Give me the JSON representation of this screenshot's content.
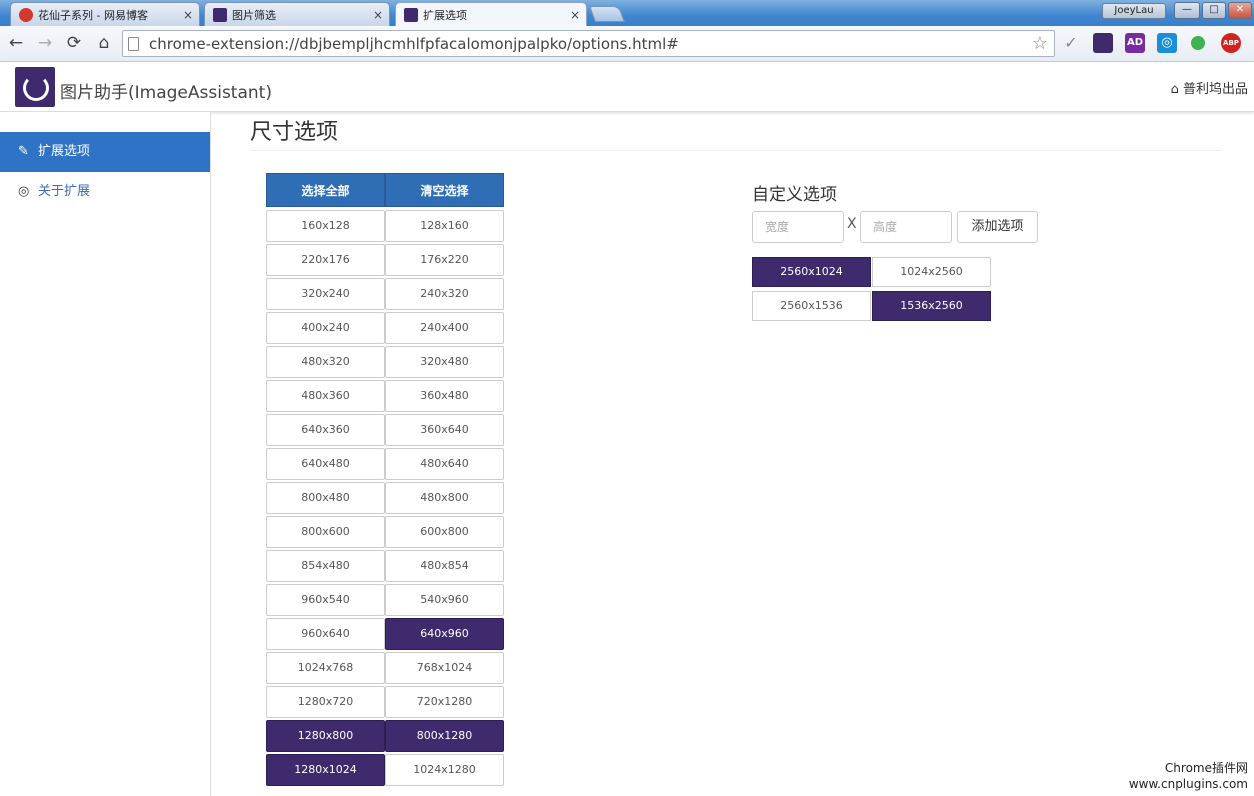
{
  "browser": {
    "tabs": [
      {
        "title": "花仙子系列 - 网易博客",
        "close": "×",
        "icon_color": "#d23a2f"
      },
      {
        "title": "图片筛选",
        "close": "×",
        "icon_color": "#3e2a6c"
      },
      {
        "title": "扩展选项",
        "close": "×",
        "icon_color": "#3e2a6c"
      }
    ],
    "user_badge": "JoeyLau",
    "window_controls": [
      "—",
      "□",
      "✕"
    ],
    "nav": {
      "back": "←",
      "forward": "→",
      "reload": "⟳",
      "home": "⌂"
    },
    "url": "chrome-extension://dbjbempljhcmhlfpfacalomonjpalpko/options.html#",
    "star": "☆",
    "extensions": [
      {
        "name": "check-icon",
        "label": "✓",
        "color": "#8a8a8a"
      },
      {
        "name": "imageassistant-extension-icon",
        "label": "",
        "color": "#3e2a6c"
      },
      {
        "name": "ad-extension-icon",
        "label": "AD",
        "color": "#7a2aa0"
      },
      {
        "name": "screenshot-extension-icon",
        "label": "◎",
        "color": "#1a8fd8"
      },
      {
        "name": "status-dot-icon",
        "label": "",
        "color": "#3eb34f"
      },
      {
        "name": "adblock-icon",
        "label": "ABP",
        "color": "#d2231f"
      }
    ]
  },
  "app": {
    "title": "图片助手(ImageAssistant)",
    "home_link": "普利坞出品",
    "accent": "#2f73c7",
    "selected_color": "#3e2a6c"
  },
  "sidebar": {
    "items": [
      {
        "label": "扩展选项",
        "icon": "✎",
        "active": true
      },
      {
        "label": "关于扩展",
        "icon": "◎",
        "active": false
      }
    ]
  },
  "main": {
    "section_title": "尺寸选项",
    "select_all": "选择全部",
    "clear_selection": "清空选择",
    "sizes": [
      {
        "a": "160x128",
        "b": "128x160",
        "a_sel": false,
        "b_sel": false
      },
      {
        "a": "220x176",
        "b": "176x220",
        "a_sel": false,
        "b_sel": false
      },
      {
        "a": "320x240",
        "b": "240x320",
        "a_sel": false,
        "b_sel": false
      },
      {
        "a": "400x240",
        "b": "240x400",
        "a_sel": false,
        "b_sel": false
      },
      {
        "a": "480x320",
        "b": "320x480",
        "a_sel": false,
        "b_sel": false
      },
      {
        "a": "480x360",
        "b": "360x480",
        "a_sel": false,
        "b_sel": false
      },
      {
        "a": "640x360",
        "b": "360x640",
        "a_sel": false,
        "b_sel": false
      },
      {
        "a": "640x480",
        "b": "480x640",
        "a_sel": false,
        "b_sel": false
      },
      {
        "a": "800x480",
        "b": "480x800",
        "a_sel": false,
        "b_sel": false
      },
      {
        "a": "800x600",
        "b": "600x800",
        "a_sel": false,
        "b_sel": false
      },
      {
        "a": "854x480",
        "b": "480x854",
        "a_sel": false,
        "b_sel": false
      },
      {
        "a": "960x540",
        "b": "540x960",
        "a_sel": false,
        "b_sel": false
      },
      {
        "a": "960x640",
        "b": "640x960",
        "a_sel": false,
        "b_sel": true
      },
      {
        "a": "1024x768",
        "b": "768x1024",
        "a_sel": false,
        "b_sel": false
      },
      {
        "a": "1280x720",
        "b": "720x1280",
        "a_sel": false,
        "b_sel": false
      },
      {
        "a": "1280x800",
        "b": "800x1280",
        "a_sel": true,
        "b_sel": true
      },
      {
        "a": "1280x1024",
        "b": "1024x1280",
        "a_sel": true,
        "b_sel": false
      }
    ]
  },
  "custom": {
    "title": "自定义选项",
    "width_placeholder": "宽度",
    "height_placeholder": "高度",
    "times": "X",
    "add_button": "添加选项",
    "options": [
      {
        "a": "2560x1024",
        "b": "1024x2560",
        "a_sel": true,
        "b_sel": false
      },
      {
        "a": "2560x1536",
        "b": "1536x2560",
        "a_sel": false,
        "b_sel": true
      }
    ]
  },
  "watermark": {
    "line1": "Chrome插件网",
    "line2": "www.cnplugins.com"
  }
}
